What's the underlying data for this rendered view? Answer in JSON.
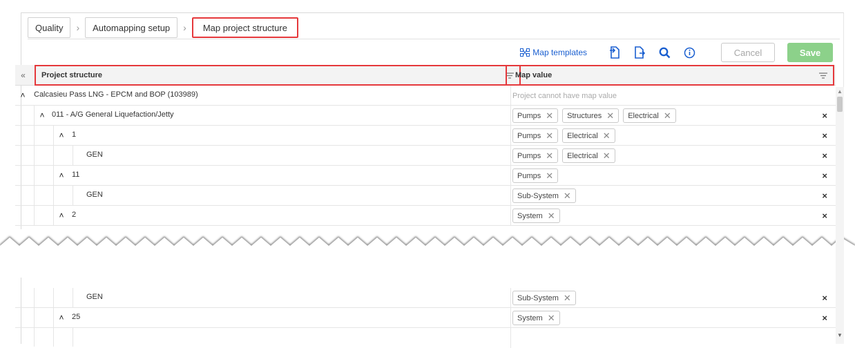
{
  "breadcrumb": [
    "Quality",
    "Automapping setup",
    "Map project structure"
  ],
  "toolbar": {
    "map_templates": "Map templates",
    "cancel": "Cancel",
    "save": "Save",
    "icons": [
      "import-icon",
      "export-icon",
      "search-icon",
      "info-icon"
    ]
  },
  "table": {
    "col_structure": "Project structure",
    "col_map_value": "Map value",
    "root": {
      "label": "Calcasieu Pass LNG - EPCM and BOP (103989)",
      "placeholder": "Project cannot have map value"
    },
    "rows": [
      {
        "label": "011 - A/G General Liquefaction/Jetty",
        "tags": [
          "Pumps",
          "Structures",
          "Electrical"
        ]
      },
      {
        "label": "1",
        "tags": [
          "Pumps",
          "Electrical"
        ]
      },
      {
        "label": "GEN",
        "tags": [
          "Pumps",
          "Electrical"
        ]
      },
      {
        "label": "11",
        "tags": [
          "Pumps"
        ]
      },
      {
        "label": "GEN",
        "tags": [
          "Sub-System"
        ]
      },
      {
        "label": "2",
        "tags": [
          "System"
        ]
      },
      {
        "label": "GEN",
        "tags": [
          "Sub-System"
        ]
      },
      {
        "label": "25",
        "tags": [
          "System"
        ]
      }
    ]
  },
  "colors": {
    "accent": "#1a5fd0",
    "save": "#8cd18a",
    "highlight": "#e5383b"
  }
}
